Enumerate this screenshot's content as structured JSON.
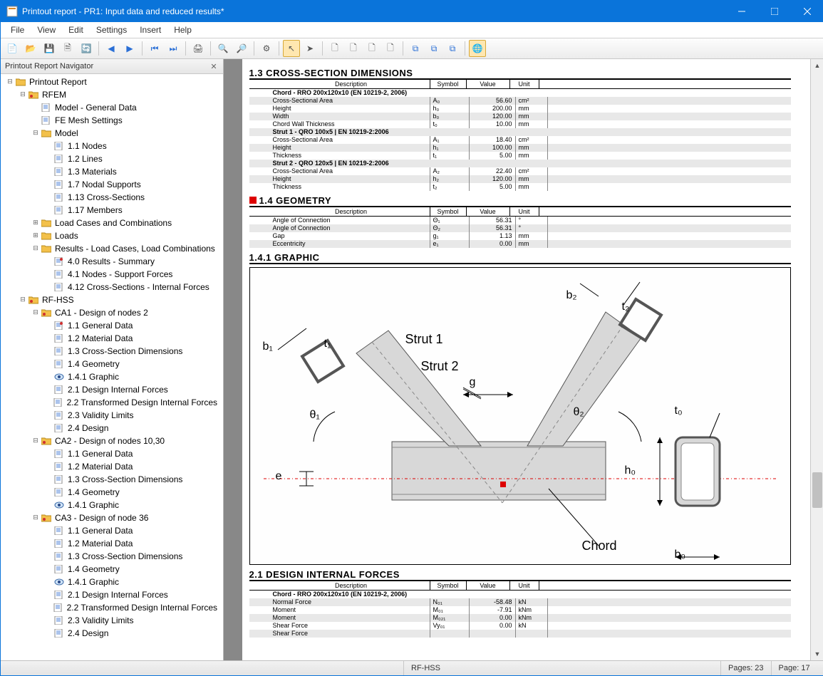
{
  "window": {
    "title": "Printout report - PR1: Input data and reduced results*"
  },
  "menus": [
    "File",
    "View",
    "Edit",
    "Settings",
    "Insert",
    "Help"
  ],
  "nav": {
    "title": "Printout Report Navigator"
  },
  "tree": [
    {
      "d": 0,
      "t": "-",
      "i": "folder",
      "l": "Printout Report"
    },
    {
      "d": 1,
      "t": "-",
      "i": "folderR",
      "l": "RFEM"
    },
    {
      "d": 2,
      "t": "",
      "i": "doc",
      "l": "Model - General Data"
    },
    {
      "d": 2,
      "t": "",
      "i": "doc",
      "l": "FE Mesh Settings"
    },
    {
      "d": 2,
      "t": "-",
      "i": "folder",
      "l": "Model"
    },
    {
      "d": 3,
      "t": "",
      "i": "doc",
      "l": "1.1 Nodes"
    },
    {
      "d": 3,
      "t": "",
      "i": "doc",
      "l": "1.2 Lines"
    },
    {
      "d": 3,
      "t": "",
      "i": "doc",
      "l": "1.3 Materials"
    },
    {
      "d": 3,
      "t": "",
      "i": "doc",
      "l": "1.7 Nodal Supports"
    },
    {
      "d": 3,
      "t": "",
      "i": "doc",
      "l": "1.13 Cross-Sections"
    },
    {
      "d": 3,
      "t": "",
      "i": "doc",
      "l": "1.17 Members"
    },
    {
      "d": 2,
      "t": "+",
      "i": "folder",
      "l": "Load Cases and Combinations"
    },
    {
      "d": 2,
      "t": "+",
      "i": "folder",
      "l": "Loads"
    },
    {
      "d": 2,
      "t": "-",
      "i": "folder",
      "l": "Results - Load Cases, Load Combinations"
    },
    {
      "d": 3,
      "t": "",
      "i": "docR",
      "l": "4.0 Results - Summary"
    },
    {
      "d": 3,
      "t": "",
      "i": "doc",
      "l": "4.1 Nodes - Support Forces"
    },
    {
      "d": 3,
      "t": "",
      "i": "doc",
      "l": "4.12 Cross-Sections - Internal Forces"
    },
    {
      "d": 1,
      "t": "-",
      "i": "folderR",
      "l": "RF-HSS"
    },
    {
      "d": 2,
      "t": "-",
      "i": "folderR",
      "l": "CA1 - Design of nodes 2"
    },
    {
      "d": 3,
      "t": "",
      "i": "docR",
      "l": "1.1 General Data"
    },
    {
      "d": 3,
      "t": "",
      "i": "doc",
      "l": "1.2 Material Data"
    },
    {
      "d": 3,
      "t": "",
      "i": "doc",
      "l": "1.3 Cross-Section Dimensions"
    },
    {
      "d": 3,
      "t": "",
      "i": "doc",
      "l": "1.4 Geometry"
    },
    {
      "d": 3,
      "t": "",
      "i": "eye",
      "l": "1.4.1 Graphic"
    },
    {
      "d": 3,
      "t": "",
      "i": "doc",
      "l": "2.1 Design Internal Forces"
    },
    {
      "d": 3,
      "t": "",
      "i": "doc",
      "l": "2.2 Transformed Design Internal Forces"
    },
    {
      "d": 3,
      "t": "",
      "i": "doc",
      "l": "2.3 Validity Limits"
    },
    {
      "d": 3,
      "t": "",
      "i": "doc",
      "l": "2.4 Design"
    },
    {
      "d": 2,
      "t": "-",
      "i": "folderR",
      "l": "CA2 - Design of nodes 10,30"
    },
    {
      "d": 3,
      "t": "",
      "i": "doc",
      "l": "1.1 General Data"
    },
    {
      "d": 3,
      "t": "",
      "i": "doc",
      "l": "1.2 Material Data"
    },
    {
      "d": 3,
      "t": "",
      "i": "doc",
      "l": "1.3 Cross-Section Dimensions"
    },
    {
      "d": 3,
      "t": "",
      "i": "doc",
      "l": "1.4 Geometry"
    },
    {
      "d": 3,
      "t": "",
      "i": "eye",
      "l": "1.4.1 Graphic"
    },
    {
      "d": 2,
      "t": "-",
      "i": "folderR",
      "l": "CA3 - Design of node 36"
    },
    {
      "d": 3,
      "t": "",
      "i": "doc",
      "l": "1.1 General Data"
    },
    {
      "d": 3,
      "t": "",
      "i": "doc",
      "l": "1.2 Material Data"
    },
    {
      "d": 3,
      "t": "",
      "i": "doc",
      "l": "1.3 Cross-Section Dimensions"
    },
    {
      "d": 3,
      "t": "",
      "i": "doc",
      "l": "1.4 Geometry"
    },
    {
      "d": 3,
      "t": "",
      "i": "eye",
      "l": "1.4.1 Graphic"
    },
    {
      "d": 3,
      "t": "",
      "i": "doc",
      "l": "2.1 Design Internal Forces"
    },
    {
      "d": 3,
      "t": "",
      "i": "doc",
      "l": "2.2 Transformed Design Internal Forces"
    },
    {
      "d": 3,
      "t": "",
      "i": "doc",
      "l": "2.3 Validity Limits"
    },
    {
      "d": 3,
      "t": "",
      "i": "doc",
      "l": "2.4 Design"
    }
  ],
  "sections": {
    "s13": {
      "title": "1.3 CROSS-SECTION DIMENSIONS",
      "cols": [
        "Description",
        "Symbol",
        "Value",
        "Unit"
      ],
      "rows": [
        {
          "b": 1,
          "d": "Chord - RRO 200x120x10 (EN 10219-2, 2006)"
        },
        {
          "d": "Cross-Sectional Area",
          "s": "A₀",
          "v": "56.60",
          "u": "cm²"
        },
        {
          "d": "Height",
          "s": "h₀",
          "v": "200.00",
          "u": "mm"
        },
        {
          "d": "Width",
          "s": "b₀",
          "v": "120.00",
          "u": "mm"
        },
        {
          "d": "Chord Wall Thickness",
          "s": "t₀",
          "v": "10.00",
          "u": "mm"
        },
        {
          "b": 1,
          "d": "Strut 1 - QRO 100x5 | EN 10219-2:2006"
        },
        {
          "d": "Cross-Sectional Area",
          "s": "A₁",
          "v": "18.40",
          "u": "cm²"
        },
        {
          "d": "Height",
          "s": "h₁",
          "v": "100.00",
          "u": "mm"
        },
        {
          "d": "Thickness",
          "s": "t₁",
          "v": "5.00",
          "u": "mm"
        },
        {
          "b": 1,
          "d": "Strut 2 - QRO 120x5 | EN 10219-2:2006"
        },
        {
          "d": "Cross-Sectional Area",
          "s": "A₂",
          "v": "22.40",
          "u": "cm²"
        },
        {
          "d": "Height",
          "s": "h₂",
          "v": "120.00",
          "u": "mm"
        },
        {
          "d": "Thickness",
          "s": "t₂",
          "v": "5.00",
          "u": "mm"
        }
      ]
    },
    "s14": {
      "title": "1.4 GEOMETRY",
      "cols": [
        "Description",
        "Symbol",
        "Value",
        "Unit"
      ],
      "rows": [
        {
          "d": "Angle of Connection",
          "s": "Θ₁",
          "v": "56.31",
          "u": "°"
        },
        {
          "d": "Angle of Connection",
          "s": "Θ₂",
          "v": "56.31",
          "u": "°"
        },
        {
          "d": "Gap",
          "s": "g₁",
          "v": "1.13",
          "u": "mm"
        },
        {
          "d": "Eccentricity",
          "s": "e₁",
          "v": "0.00",
          "u": "mm"
        }
      ]
    },
    "s141": {
      "title": "1.4.1 GRAPHIC",
      "labels": {
        "b1": "b₁",
        "t1": "t₁",
        "b2": "b₂",
        "t2": "t₂",
        "strut1": "Strut 1",
        "strut2": "Strut 2",
        "g": "g",
        "th1": "θ₁",
        "th2": "θ₂",
        "e": "e",
        "t0": "t₀",
        "h0": "h₀",
        "b0": "b₀",
        "chord": "Chord"
      }
    },
    "s21": {
      "title": "2.1 DESIGN INTERNAL FORCES",
      "cols": [
        "Description",
        "Symbol",
        "Value",
        "Unit"
      ],
      "rows": [
        {
          "b": 1,
          "d": "Chord - RRO 200x120x10 (EN 10219-2, 2006)"
        },
        {
          "d": "Normal Force",
          "s": "N₀₁",
          "v": "-58.48",
          "u": "kN"
        },
        {
          "d": "Moment",
          "s": "M₀₁",
          "v": "-7.91",
          "u": "kNm"
        },
        {
          "d": "Moment",
          "s": "M₀₂₁",
          "v": "0.00",
          "u": "kNm"
        },
        {
          "d": "Shear Force",
          "s": "Vy₀₁",
          "v": "0.00",
          "u": "kN"
        },
        {
          "d": "Shear Force",
          "s": "",
          "v": "",
          "u": ""
        }
      ]
    }
  },
  "status": {
    "module": "RF-HSS",
    "pages": "Pages: 23",
    "page": "Page: 17"
  }
}
